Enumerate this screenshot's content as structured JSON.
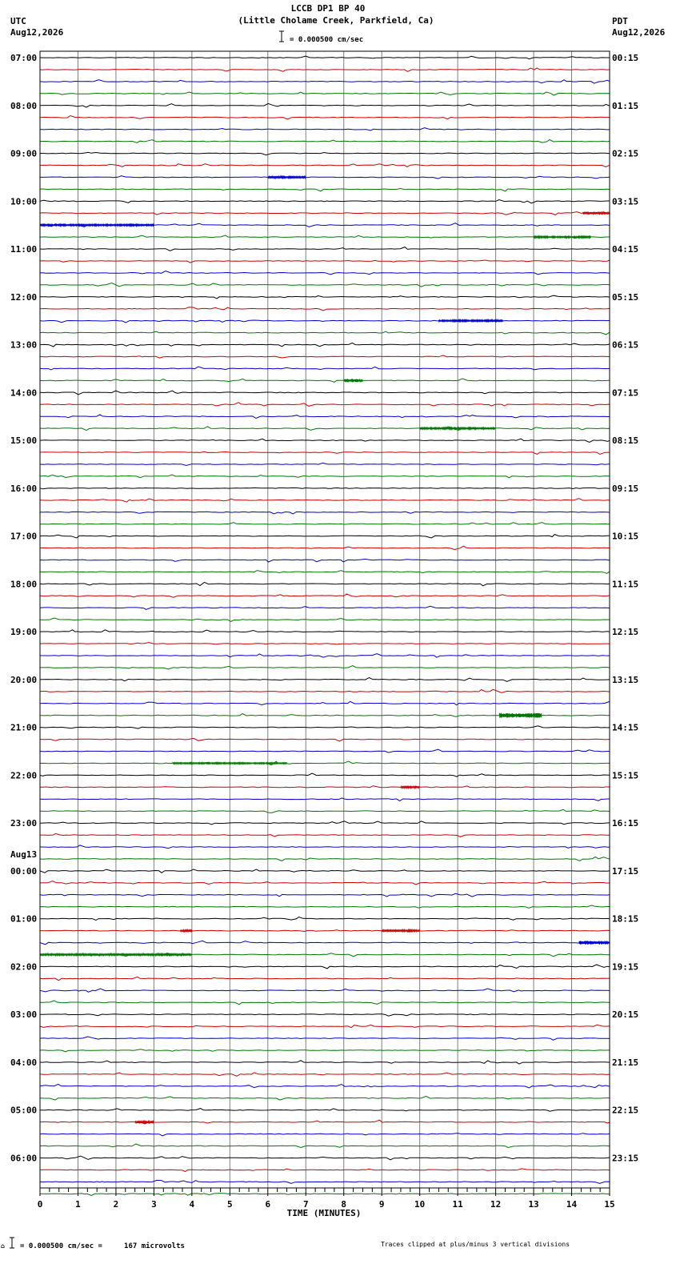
{
  "header": {
    "title": "LCCB DP1 BP 40",
    "subtitle": "(Little Cholame Creek, Parkfield, Ca)",
    "scale_text": "= 0.000500 cm/sec",
    "left_tz": "UTC",
    "left_date": "Aug12,2026",
    "right_tz": "PDT",
    "right_date": "Aug12,2026"
  },
  "footer": {
    "scale_text": "= 0.000500 cm/sec =     167 microvolts",
    "clip_note": "Traces clipped at plus/minus 3 vertical divisions"
  },
  "chart_data": {
    "type": "line",
    "xlabel": "TIME (MINUTES)",
    "xlim": [
      0,
      15
    ],
    "x_ticks": [
      0,
      1,
      2,
      3,
      4,
      5,
      6,
      7,
      8,
      9,
      10,
      11,
      12,
      13,
      14,
      15
    ],
    "trace_count": 96,
    "trace_colors": [
      "#000000",
      "#cc0000",
      "#0000cc",
      "#007700"
    ],
    "day_change": {
      "label": "Aug13",
      "row": 68
    },
    "left_labels": [
      "07:00",
      "08:00",
      "09:00",
      "10:00",
      "11:00",
      "12:00",
      "13:00",
      "14:00",
      "15:00",
      "16:00",
      "17:00",
      "18:00",
      "19:00",
      "20:00",
      "21:00",
      "22:00",
      "23:00",
      "00:00",
      "01:00",
      "02:00",
      "03:00",
      "04:00",
      "05:00",
      "06:00"
    ],
    "right_labels": [
      "00:15",
      "01:15",
      "02:15",
      "03:15",
      "04:15",
      "05:15",
      "06:15",
      "07:15",
      "08:15",
      "09:15",
      "10:15",
      "11:15",
      "12:15",
      "13:15",
      "14:15",
      "15:15",
      "16:15",
      "17:15",
      "18:15",
      "19:15",
      "20:15",
      "21:15",
      "22:15",
      "23:15"
    ],
    "events": [
      {
        "row": 10,
        "x_start": 6.0,
        "x_end": 7.0,
        "amplitude": 1.2
      },
      {
        "row": 13,
        "x_start": 14.3,
        "x_end": 15.0,
        "amplitude": 1.4
      },
      {
        "row": 14,
        "x_start": 0.0,
        "x_end": 3.0,
        "amplitude": 1.0
      },
      {
        "row": 15,
        "x_start": 13.0,
        "x_end": 14.5,
        "amplitude": 1.0
      },
      {
        "row": 22,
        "x_start": 10.5,
        "x_end": 12.2,
        "amplitude": 1.0
      },
      {
        "row": 27,
        "x_start": 8.0,
        "x_end": 8.5,
        "amplitude": 2.0
      },
      {
        "row": 31,
        "x_start": 10.0,
        "x_end": 12.0,
        "amplitude": 1.0
      },
      {
        "row": 55,
        "x_start": 12.1,
        "x_end": 13.2,
        "amplitude": 3.0
      },
      {
        "row": 59,
        "x_start": 3.5,
        "x_end": 6.5,
        "amplitude": 0.8
      },
      {
        "row": 61,
        "x_start": 9.5,
        "x_end": 10.0,
        "amplitude": 1.2
      },
      {
        "row": 73,
        "x_start": 3.7,
        "x_end": 4.0,
        "amplitude": 1.4
      },
      {
        "row": 73,
        "x_start": 9.0,
        "x_end": 10.0,
        "amplitude": 1.2
      },
      {
        "row": 74,
        "x_start": 14.2,
        "x_end": 15.0,
        "amplitude": 2.2
      },
      {
        "row": 75,
        "x_start": 0.0,
        "x_end": 4.0,
        "amplitude": 1.2
      },
      {
        "row": 89,
        "x_start": 2.5,
        "x_end": 3.0,
        "amplitude": 1.4
      }
    ]
  }
}
